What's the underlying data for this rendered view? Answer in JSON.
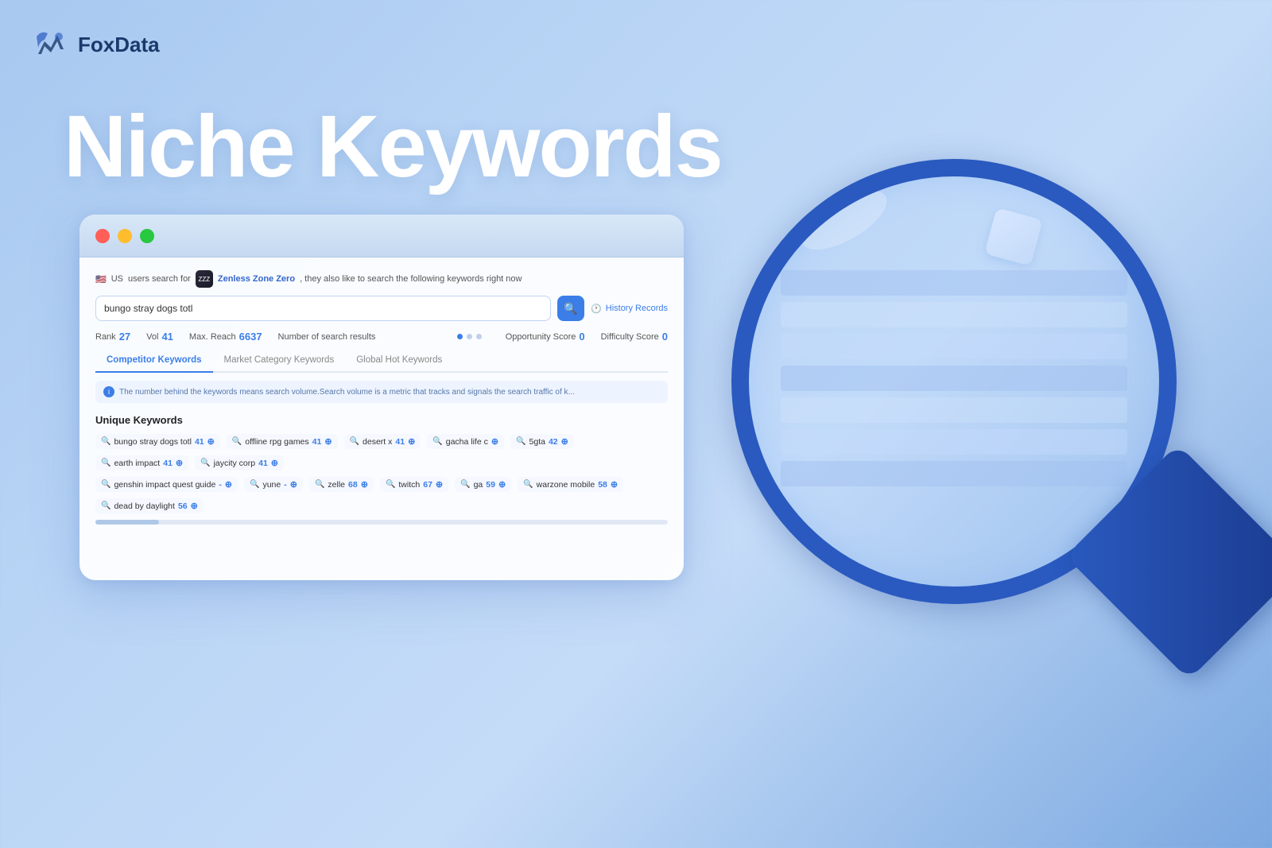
{
  "logo": {
    "text": "FoxData"
  },
  "main_title": "Niche Keywords",
  "browser": {
    "titlebar": {
      "dots": [
        "red",
        "yellow",
        "green"
      ]
    },
    "search_desc": {
      "flag": "🇺🇸",
      "country": "US",
      "prefix": "users search for",
      "app_name": "Zenless Zone Zero",
      "suffix": ", they also like to search the following keywords right now"
    },
    "search_input": {
      "value": "bungo stray dogs totl",
      "placeholder": "bungo stray dogs totl"
    },
    "search_button_icon": "🔍",
    "history_label": "History Records",
    "stats": [
      {
        "label": "Rank",
        "value": "27"
      },
      {
        "label": "Vol",
        "value": "41"
      },
      {
        "label": "Max. Reach",
        "value": "6637"
      },
      {
        "label": "Number of search results",
        "value": ""
      }
    ],
    "right_stats": [
      {
        "label": "Opportunity Score",
        "value": "0"
      },
      {
        "label": "Difficulty Score",
        "value": "0"
      }
    ],
    "tabs": [
      {
        "label": "Competitor Keywords",
        "active": true
      },
      {
        "label": "Market Category Keywords",
        "active": false
      },
      {
        "label": "Global Hot Keywords",
        "active": false
      }
    ],
    "info_text": "The number behind the keywords means search volume.Search volume is a metric that tracks and signals the search traffic of k...",
    "section_unique": "Unique Keywords",
    "keywords_row1": [
      {
        "text": "bungo stray dogs totl",
        "vol": "41"
      },
      {
        "text": "offline rpg games",
        "vol": "41"
      },
      {
        "text": "desert x",
        "vol": "41"
      },
      {
        "text": "gacha life c",
        "vol": ""
      },
      {
        "text": "5gta",
        "vol": "42"
      },
      {
        "text": "earth impact",
        "vol": "41"
      },
      {
        "text": "jaycity corp",
        "vol": "41"
      }
    ],
    "keywords_row2": [
      {
        "text": "genshin impact quest guide",
        "vol": "-"
      },
      {
        "text": "yune",
        "vol": "-"
      },
      {
        "text": "zelle",
        "vol": "68"
      },
      {
        "text": "twitch",
        "vol": "67"
      },
      {
        "text": "ga",
        "vol": "59"
      },
      {
        "text": "warzone mobile",
        "vol": "58"
      },
      {
        "text": "dead by daylight",
        "vol": "56"
      }
    ]
  }
}
